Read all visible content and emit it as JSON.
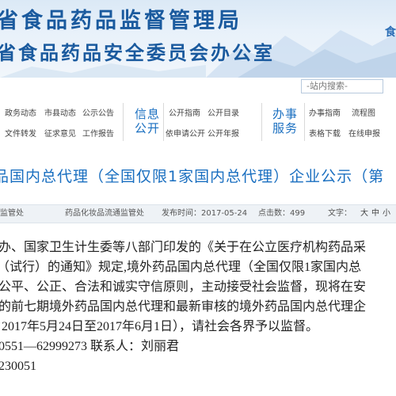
{
  "header": {
    "title_line1": "省食品药品监督管理局",
    "title_line2": "省食品药品安全委员会办公室",
    "corner_char": "食",
    "search_placeholder": "-站内搜索-"
  },
  "nav": {
    "group1": [
      {
        "label": "政务动态"
      },
      {
        "label": "市县动态"
      },
      {
        "label": "公示公告"
      },
      {
        "label": "文件转发"
      },
      {
        "label": "征求意见"
      },
      {
        "label": "工作报告"
      }
    ],
    "info_open": {
      "line1": "信息",
      "line2": "公开"
    },
    "group2": [
      {
        "label": "公开指南"
      },
      {
        "label": "公开目录"
      },
      {
        "label": "依申请公开"
      },
      {
        "label": "公开年报"
      }
    ],
    "services": {
      "line1": "办事",
      "line2": "服务"
    },
    "group3": [
      {
        "label": "办事指南"
      },
      {
        "label": "流程图"
      },
      {
        "label": "表格下载"
      },
      {
        "label": "在线申报"
      }
    ]
  },
  "article": {
    "headline": "品国内总代理（全国仅限1家国内总代理）企业公示（第",
    "meta": {
      "source": "监管处",
      "author": "药品化妆品流通监管处",
      "date": "发布时间：2017-05-24",
      "views": "点击数：499",
      "size_label": "文字：",
      "size_large": "大",
      "size_medium": "中",
      "size_small": "小"
    },
    "paragraphs": [
      "办、国家卫生计生委等八部门印发的《关于在公立医疗机构药品采",
      "（试行）的通知》规定,境外药品国内总代理（全国仅限1家国内总",
      "公平、公正、合法和诚实守信原则，主动接受社会监督，现将在安",
      "的前七期境外药品国内总代理和最新审核的境外药品国内总代理企",
      "2017年5月24日至2017年6月1日），请社会各界予以监督。",
      "0551—62999273   联系人：刘丽君",
      "230051"
    ]
  },
  "colors": {
    "brand_blue": "#1a5a9e",
    "link_blue": "#1a6fc0",
    "meta_bg": "#eef2f6"
  }
}
